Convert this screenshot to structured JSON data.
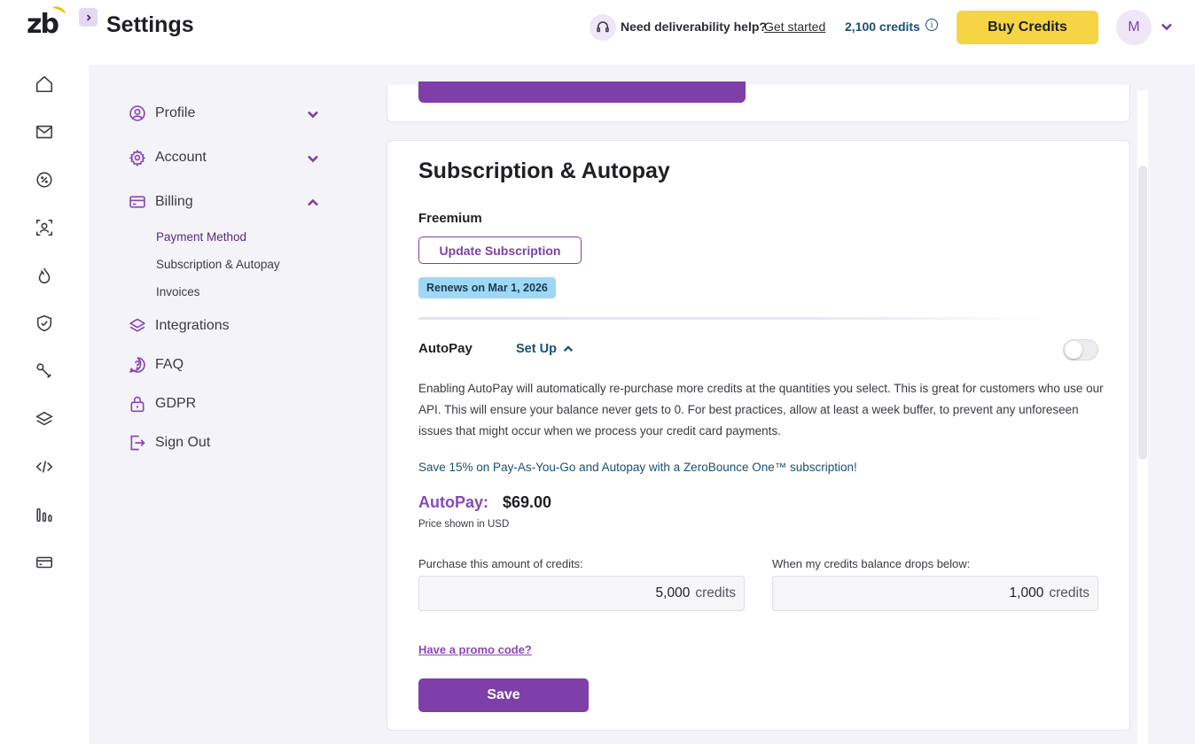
{
  "app": {
    "logo_text": "zb",
    "page_title": "Settings"
  },
  "header": {
    "help_text": "Need deliverability help?",
    "help_link": "Get started",
    "credits": "2,100 credits",
    "buy_label": "Buy Credits",
    "avatar_initial": "M"
  },
  "rail": {
    "icons": [
      "home-icon",
      "mail-icon",
      "percent-badge-icon",
      "contact-scan-icon",
      "flame-icon",
      "shield-check-icon",
      "tools-icon",
      "layers-icon",
      "code-icon",
      "bar-chart-icon",
      "credit-card-icon"
    ]
  },
  "settings_nav": {
    "items": [
      {
        "label": "Profile",
        "icon": "user-circle-icon",
        "expanded": false
      },
      {
        "label": "Account",
        "icon": "gear-icon",
        "expanded": false
      },
      {
        "label": "Billing",
        "icon": "credit-card-icon",
        "expanded": true
      },
      {
        "label": "Integrations",
        "icon": "layers-icon"
      },
      {
        "label": "FAQ",
        "icon": "question-icon"
      },
      {
        "label": "GDPR",
        "icon": "lock-icon"
      },
      {
        "label": "Sign Out",
        "icon": "sign-out-icon"
      }
    ],
    "billing_sub": [
      "Payment Method",
      "Subscription & Autopay",
      "Invoices"
    ]
  },
  "subscription": {
    "title": "Subscription & Autopay",
    "plan": "Freemium",
    "update_label": "Update Subscription",
    "renew_badge": "Renews on Mar 1, 2026",
    "autopay_label": "AutoPay",
    "setup_label": "Set Up",
    "autopay_enabled": false,
    "description": "Enabling AutoPay will automatically re-purchase more credits at the quantities you select. This is great for customers who use our API. This will ensure your balance never gets to 0. For best practices, allow at least a week buffer, to prevent any unforeseen issues that might occur when we process your credit card payments.",
    "promo_line": "Save 15% on Pay-As-You-Go and Autopay with a ZeroBounce One™ subscription!",
    "price_label": "AutoPay:",
    "price": "$69.00",
    "price_note": "Price shown in USD",
    "purchase_label": "Purchase this amount of credits:",
    "purchase_value": "5,000",
    "threshold_label": "When my credits balance drops below:",
    "threshold_value": "1,000",
    "unit": "credits",
    "promo_code_link": "Have a promo code?",
    "save_label": "Save"
  },
  "colors": {
    "brand_purple": "#7e3fa8",
    "accent_yellow": "#f5d544",
    "badge_blue": "#9fd8f5",
    "link_blue": "#1b4f72"
  }
}
